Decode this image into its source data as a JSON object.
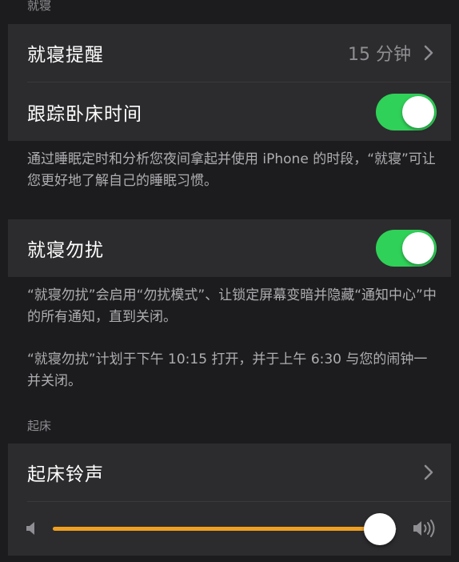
{
  "bedtime": {
    "header": "就寝",
    "reminder": {
      "label": "就寝提醒",
      "value": "15 分钟"
    },
    "track": {
      "label": "跟踪卧床时间",
      "on": true
    },
    "track_footer": "通过睡眠定时和分析您夜间拿起并使用 iPhone 的时段，“就寝”可让您更好地了解自己的睡眠习惯。",
    "dnd": {
      "label": "就寝勿扰",
      "on": true
    },
    "dnd_footer_1": "“就寝勿扰”会启用“勿扰模式”、让锁定屏幕变暗并隐藏“通知中心”中的所有通知，直到关闭。",
    "dnd_footer_2": "“就寝勿扰”计划于下午 10:15 打开，并于上午 6:30 与您的闹钟一并关闭。"
  },
  "wake": {
    "header": "起床",
    "sound": {
      "label": "起床铃声"
    },
    "volume": {
      "level": 0.95,
      "accent": "#f0a020"
    }
  },
  "icons": {
    "volume_low": "speaker-low-icon",
    "volume_high": "speaker-high-icon",
    "chevron": "chevron-right-icon"
  },
  "colors": {
    "toggle_on": "#30d158",
    "background": "#1c1c1e",
    "cell": "#2c2c2e"
  }
}
